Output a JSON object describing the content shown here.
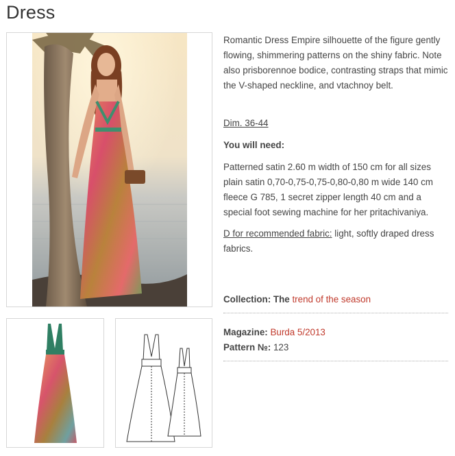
{
  "page": {
    "title": "Dress"
  },
  "images": {
    "main_alt": "woman in long dress by palm tree",
    "thumb_alt": "dress photo",
    "sketch_alt": "dress technical sketch"
  },
  "description": {
    "text": "Romantic Dress Empire silhouette of the figure gently flowing, shimmering patterns on the shiny fabric. Note also prisborennoe bodice, contrasting straps that mimic the V-shaped neckline, and vtachnoy belt.",
    "dims": "Dim. 36-44",
    "need_heading": "You will need:",
    "need_text": "Patterned satin 2.60 m width of 150 cm for all sizes plain satin 0,70-0,75-0,75-0,80-0,80 m wide 140 cm fleece G 785, 1 secret zipper length 40 cm and a special foot sewing machine for her pritachivaniya.",
    "fabric_label": "D for recommended fabric:",
    "fabric_text": " light, softly draped dress fabrics."
  },
  "meta": {
    "collection_label": "Collection:",
    "collection_the": " The ",
    "collection_link": "trend of the season",
    "magazine_label": "Magazine:",
    "magazine_link": "Burda 5/2013",
    "pattern_label": "Pattern №:",
    "pattern_value": " 123"
  },
  "colors": {
    "link": "#c0392b",
    "text": "#444444",
    "border": "#d6d6d6"
  }
}
